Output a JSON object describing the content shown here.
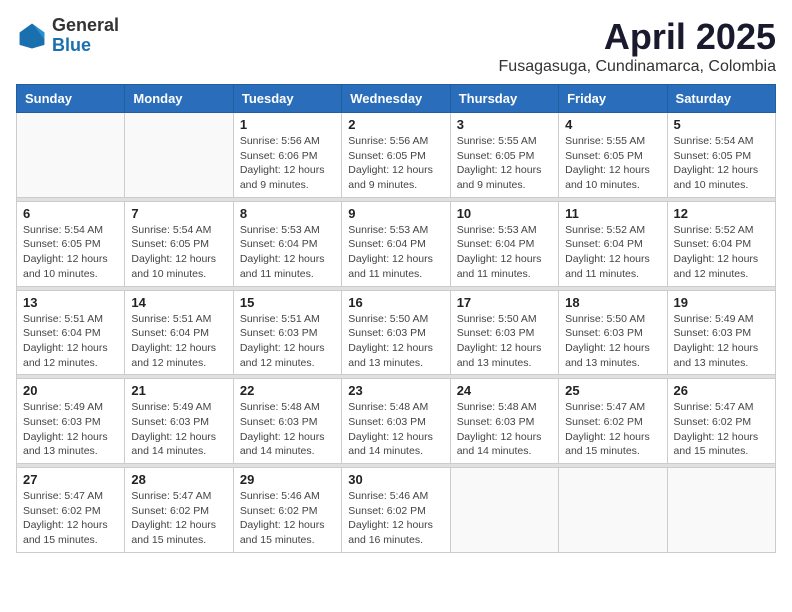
{
  "header": {
    "logo_general": "General",
    "logo_blue": "Blue",
    "title": "April 2025",
    "subtitle": "Fusagasuga, Cundinamarca, Colombia"
  },
  "calendar": {
    "days_of_week": [
      "Sunday",
      "Monday",
      "Tuesday",
      "Wednesday",
      "Thursday",
      "Friday",
      "Saturday"
    ],
    "weeks": [
      [
        {
          "day": "",
          "info": ""
        },
        {
          "day": "",
          "info": ""
        },
        {
          "day": "1",
          "info": "Sunrise: 5:56 AM\nSunset: 6:06 PM\nDaylight: 12 hours\nand 9 minutes."
        },
        {
          "day": "2",
          "info": "Sunrise: 5:56 AM\nSunset: 6:05 PM\nDaylight: 12 hours\nand 9 minutes."
        },
        {
          "day": "3",
          "info": "Sunrise: 5:55 AM\nSunset: 6:05 PM\nDaylight: 12 hours\nand 9 minutes."
        },
        {
          "day": "4",
          "info": "Sunrise: 5:55 AM\nSunset: 6:05 PM\nDaylight: 12 hours\nand 10 minutes."
        },
        {
          "day": "5",
          "info": "Sunrise: 5:54 AM\nSunset: 6:05 PM\nDaylight: 12 hours\nand 10 minutes."
        }
      ],
      [
        {
          "day": "6",
          "info": "Sunrise: 5:54 AM\nSunset: 6:05 PM\nDaylight: 12 hours\nand 10 minutes."
        },
        {
          "day": "7",
          "info": "Sunrise: 5:54 AM\nSunset: 6:05 PM\nDaylight: 12 hours\nand 10 minutes."
        },
        {
          "day": "8",
          "info": "Sunrise: 5:53 AM\nSunset: 6:04 PM\nDaylight: 12 hours\nand 11 minutes."
        },
        {
          "day": "9",
          "info": "Sunrise: 5:53 AM\nSunset: 6:04 PM\nDaylight: 12 hours\nand 11 minutes."
        },
        {
          "day": "10",
          "info": "Sunrise: 5:53 AM\nSunset: 6:04 PM\nDaylight: 12 hours\nand 11 minutes."
        },
        {
          "day": "11",
          "info": "Sunrise: 5:52 AM\nSunset: 6:04 PM\nDaylight: 12 hours\nand 11 minutes."
        },
        {
          "day": "12",
          "info": "Sunrise: 5:52 AM\nSunset: 6:04 PM\nDaylight: 12 hours\nand 12 minutes."
        }
      ],
      [
        {
          "day": "13",
          "info": "Sunrise: 5:51 AM\nSunset: 6:04 PM\nDaylight: 12 hours\nand 12 minutes."
        },
        {
          "day": "14",
          "info": "Sunrise: 5:51 AM\nSunset: 6:04 PM\nDaylight: 12 hours\nand 12 minutes."
        },
        {
          "day": "15",
          "info": "Sunrise: 5:51 AM\nSunset: 6:03 PM\nDaylight: 12 hours\nand 12 minutes."
        },
        {
          "day": "16",
          "info": "Sunrise: 5:50 AM\nSunset: 6:03 PM\nDaylight: 12 hours\nand 13 minutes."
        },
        {
          "day": "17",
          "info": "Sunrise: 5:50 AM\nSunset: 6:03 PM\nDaylight: 12 hours\nand 13 minutes."
        },
        {
          "day": "18",
          "info": "Sunrise: 5:50 AM\nSunset: 6:03 PM\nDaylight: 12 hours\nand 13 minutes."
        },
        {
          "day": "19",
          "info": "Sunrise: 5:49 AM\nSunset: 6:03 PM\nDaylight: 12 hours\nand 13 minutes."
        }
      ],
      [
        {
          "day": "20",
          "info": "Sunrise: 5:49 AM\nSunset: 6:03 PM\nDaylight: 12 hours\nand 13 minutes."
        },
        {
          "day": "21",
          "info": "Sunrise: 5:49 AM\nSunset: 6:03 PM\nDaylight: 12 hours\nand 14 minutes."
        },
        {
          "day": "22",
          "info": "Sunrise: 5:48 AM\nSunset: 6:03 PM\nDaylight: 12 hours\nand 14 minutes."
        },
        {
          "day": "23",
          "info": "Sunrise: 5:48 AM\nSunset: 6:03 PM\nDaylight: 12 hours\nand 14 minutes."
        },
        {
          "day": "24",
          "info": "Sunrise: 5:48 AM\nSunset: 6:03 PM\nDaylight: 12 hours\nand 14 minutes."
        },
        {
          "day": "25",
          "info": "Sunrise: 5:47 AM\nSunset: 6:02 PM\nDaylight: 12 hours\nand 15 minutes."
        },
        {
          "day": "26",
          "info": "Sunrise: 5:47 AM\nSunset: 6:02 PM\nDaylight: 12 hours\nand 15 minutes."
        }
      ],
      [
        {
          "day": "27",
          "info": "Sunrise: 5:47 AM\nSunset: 6:02 PM\nDaylight: 12 hours\nand 15 minutes."
        },
        {
          "day": "28",
          "info": "Sunrise: 5:47 AM\nSunset: 6:02 PM\nDaylight: 12 hours\nand 15 minutes."
        },
        {
          "day": "29",
          "info": "Sunrise: 5:46 AM\nSunset: 6:02 PM\nDaylight: 12 hours\nand 15 minutes."
        },
        {
          "day": "30",
          "info": "Sunrise: 5:46 AM\nSunset: 6:02 PM\nDaylight: 12 hours\nand 16 minutes."
        },
        {
          "day": "",
          "info": ""
        },
        {
          "day": "",
          "info": ""
        },
        {
          "day": "",
          "info": ""
        }
      ]
    ]
  }
}
